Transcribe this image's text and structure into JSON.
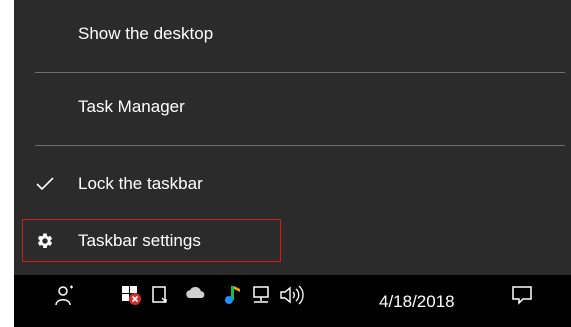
{
  "context_menu": {
    "items": [
      {
        "label": "Show the desktop",
        "icon": "",
        "checked": false
      },
      {
        "label": "Task Manager",
        "icon": "",
        "checked": false
      },
      {
        "label": "Lock the taskbar",
        "icon": "checkmark-icon",
        "checked": true
      },
      {
        "label": "Taskbar settings",
        "icon": "gear-icon",
        "checked": false
      }
    ],
    "highlighted_item": "Taskbar settings",
    "colors": {
      "background": "#2b2b2b",
      "text": "#ffffff",
      "divider": "#6e6e6e",
      "highlight_border": "#d21a1a"
    }
  },
  "taskbar": {
    "tray_icons": [
      "people-icon",
      "security-warning-icon",
      "tablet-mode-icon",
      "onedrive-cloud-icon",
      "music-app-icon",
      "network-icon",
      "volume-icon",
      "action-center-icon"
    ],
    "clock_date": "4/18/2018",
    "colors": {
      "background": "#000000",
      "text": "#ffffff"
    }
  }
}
